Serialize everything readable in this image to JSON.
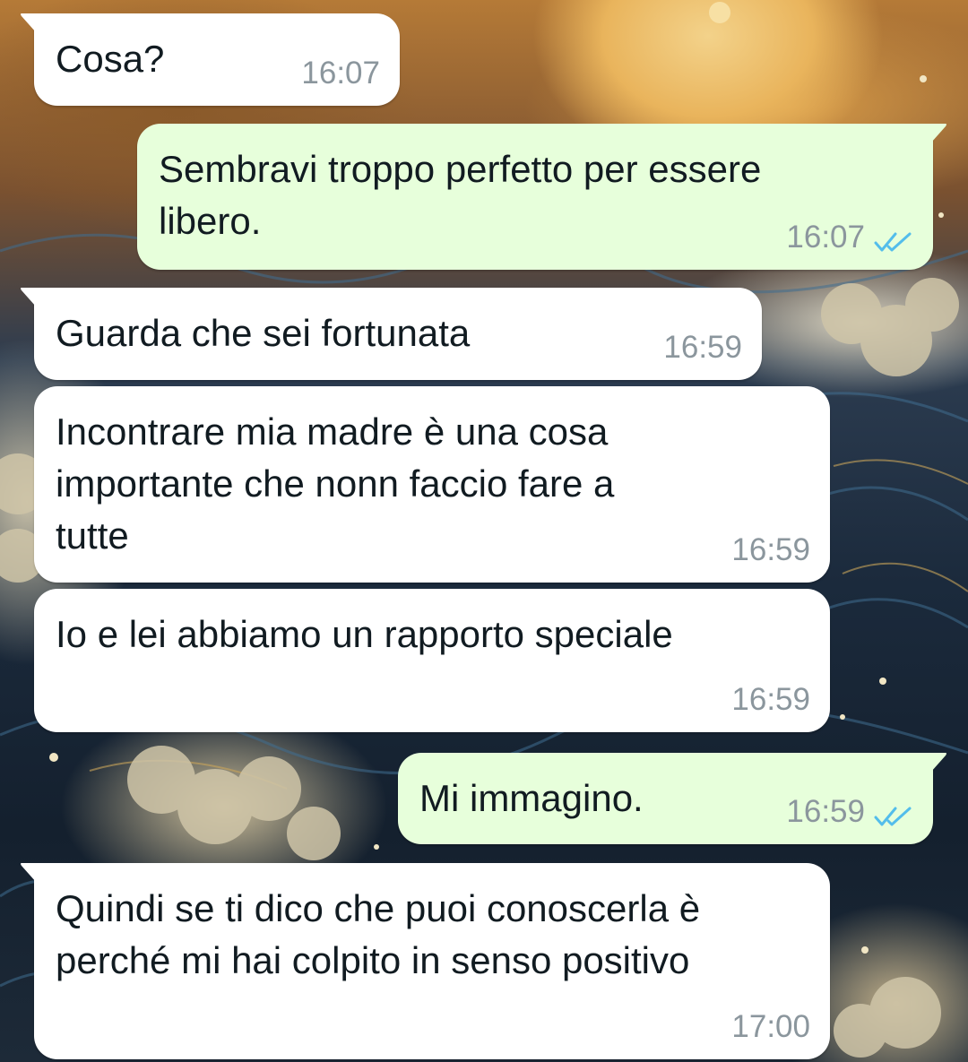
{
  "colors": {
    "incoming_bubble": "#ffffff",
    "outgoing_bubble": "#e7ffdb",
    "message_text": "#111b21",
    "timestamp": "#8b969d",
    "read_ticks": "#53bdeb"
  },
  "messages": [
    {
      "direction": "incoming",
      "text": "Cosa?",
      "time": "16:07"
    },
    {
      "direction": "outgoing",
      "text": "Sembravi troppo perfetto per essere\nlibero.",
      "time": "16:07",
      "status": "read",
      "status_icon": "double-check-icon"
    },
    {
      "direction": "incoming",
      "text": "Guarda che sei fortunata",
      "time": "16:59"
    },
    {
      "direction": "incoming",
      "text": "Incontrare mia madre è una cosa\nimportante che nonn faccio fare a\ntutte",
      "time": "16:59"
    },
    {
      "direction": "incoming",
      "text": "Io e lei abbiamo un rapporto speciale",
      "time": "16:59"
    },
    {
      "direction": "outgoing",
      "text": "Mi immagino.",
      "time": "16:59",
      "status": "read",
      "status_icon": "double-check-icon"
    },
    {
      "direction": "incoming",
      "text": "Quindi se ti dico che puoi conoscerla è\nperché mi hai colpito in senso positivo",
      "time": "17:00"
    }
  ]
}
